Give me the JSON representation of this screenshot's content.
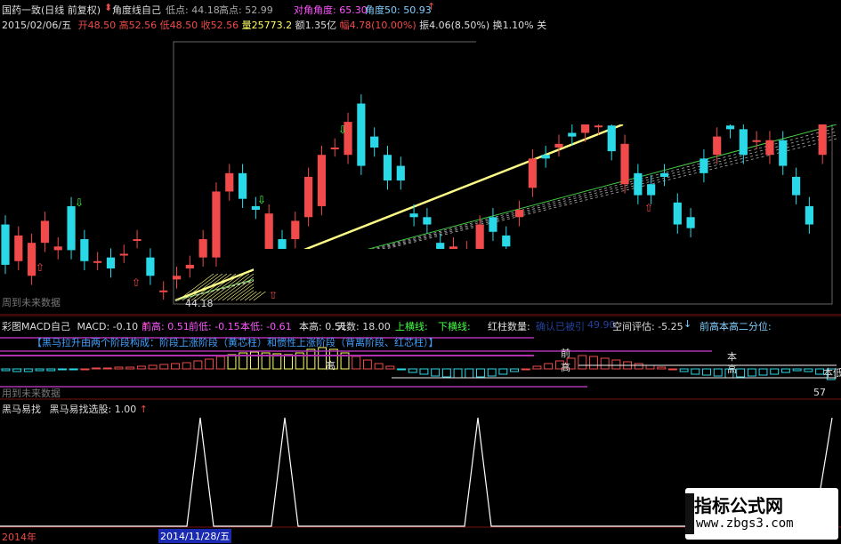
{
  "colors": {
    "up": "#f04a4a",
    "down": "#2ad9e8",
    "bg": "#000000",
    "axis": "#7a1010",
    "yellow": "#ffff66",
    "magenta": "#b030b0"
  },
  "header": {
    "title": "国药一致(日线 前复权)",
    "indicator_name": "角度线自己",
    "low_label": "低点: 44.18",
    "high_label": "高点: 52.99",
    "diag_angle": "对角角度: 65.30",
    "angle50": "角度50: 50.93"
  },
  "info": {
    "date": "2015/02/06/五",
    "open": "开48.50",
    "high": "高52.56",
    "low": "低48.50",
    "close": "收52.56",
    "vol": "量25773.2",
    "amount": "额1.35亿",
    "range": "幅4.78(10.00%)",
    "amp": "振4.06(8.50%)",
    "turn": "换1.10%",
    "tail": "关"
  },
  "price_chart": {
    "low_marker": "44.18",
    "future_label": "周到未来数据"
  },
  "macd_header": {
    "name": "彩图MACD自己",
    "macd": "MACD: -0.10",
    "prev_high": "前高: 0.51",
    "prev_low": "前低: -0.15",
    "cur_low": "本低: -0.61",
    "cur_high": "本高: 0.51",
    "days": "天数: 18.00",
    "up_line": "上横线:",
    "down_line": "下横线:",
    "red_count": "红柱数量:",
    "blurred": "确认已被引",
    "blurred_val": "49.90",
    "space": "空间评估: -5.25",
    "high2": "前高本高二分位:"
  },
  "macd_chart": {
    "banner": "【黑马拉升由两个阶段构成：阶段上涨阶段（黄芯柱）和惯性上涨阶段（背离阶段、红芯柱）】",
    "gao": "高",
    "qian": "前",
    "ben": "本",
    "lian": "本低",
    "val57": "57",
    "future_label": "用到未来数据"
  },
  "signal_header": {
    "name": "黑马易找",
    "value": "黑马易找选股: 1.00"
  },
  "footer": {
    "year": "2014年",
    "date": "2014/11/28/五"
  },
  "watermark": {
    "title": "指标公式网",
    "url": "www.zbgs3.com"
  },
  "chart_data": {
    "type": "candlestick",
    "candles": [
      {
        "o": 49.3,
        "c": 48.2
      },
      {
        "o": 48.3,
        "c": 49.0
      },
      {
        "o": 47.9,
        "c": 48.8
      },
      {
        "o": 48.8,
        "c": 49.4
      },
      {
        "o": 48.6,
        "c": 48.7
      },
      {
        "o": 49.8,
        "c": 48.6
      },
      {
        "o": 48.9,
        "c": 48.3
      },
      {
        "o": 48.3,
        "c": 48.3
      },
      {
        "o": 48.4,
        "c": 48.1
      },
      {
        "o": 48.5,
        "c": 48.5
      },
      {
        "o": 48.9,
        "c": 48.9
      },
      {
        "o": 48.4,
        "c": 47.9
      },
      {
        "o": 47.5,
        "c": 47.5
      },
      {
        "o": 47.8,
        "c": 47.9
      },
      {
        "o": 48.1,
        "c": 48.2
      },
      {
        "o": 48.4,
        "c": 48.9
      },
      {
        "o": 48.4,
        "c": 50.2
      },
      {
        "o": 50.2,
        "c": 50.7
      },
      {
        "o": 50.7,
        "c": 50.0
      },
      {
        "o": 49.8,
        "c": 49.7
      },
      {
        "o": 48.4,
        "c": 49.6
      },
      {
        "o": 48.9,
        "c": 48.5
      },
      {
        "o": 48.9,
        "c": 49.4
      },
      {
        "o": 49.5,
        "c": 50.6
      },
      {
        "o": 49.8,
        "c": 51.2
      },
      {
        "o": 51.4,
        "c": 51.4
      },
      {
        "o": 51.2,
        "c": 52.1
      },
      {
        "o": 52.6,
        "c": 50.9
      },
      {
        "o": 51.7,
        "c": 51.4
      },
      {
        "o": 51.2,
        "c": 50.5
      },
      {
        "o": 50.9,
        "c": 50.5
      },
      {
        "o": 49.6,
        "c": 49.5
      },
      {
        "o": 49.5,
        "c": 49.3
      },
      {
        "o": 48.8,
        "c": 48.5
      },
      {
        "o": 48.5,
        "c": 48.7
      },
      {
        "o": 48.4,
        "c": 48.6
      },
      {
        "o": 48.6,
        "c": 49.3
      },
      {
        "o": 49.5,
        "c": 49.1
      },
      {
        "o": 49.0,
        "c": 48.7
      },
      {
        "o": 49.5,
        "c": 49.7
      },
      {
        "o": 50.3,
        "c": 51.1
      },
      {
        "o": 51.2,
        "c": 51.1
      },
      {
        "o": 51.4,
        "c": 51.5
      },
      {
        "o": 51.8,
        "c": 51.7
      },
      {
        "o": 51.8,
        "c": 52.3
      },
      {
        "o": 52.0,
        "c": 52.0
      },
      {
        "o": 52.0,
        "c": 51.3
      },
      {
        "o": 50.4,
        "c": 51.5
      },
      {
        "o": 50.7,
        "c": 50.1
      },
      {
        "o": 50.4,
        "c": 50.1
      },
      {
        "o": 50.7,
        "c": 50.6
      },
      {
        "o": 49.9,
        "c": 49.3
      },
      {
        "o": 49.5,
        "c": 49.2
      },
      {
        "o": 51.1,
        "c": 50.7
      },
      {
        "o": 51.2,
        "c": 51.7
      },
      {
        "o": 52.0,
        "c": 51.9
      },
      {
        "o": 51.9,
        "c": 51.2
      },
      {
        "o": 51.6,
        "c": 51.6
      },
      {
        "o": 51.2,
        "c": 51.6
      },
      {
        "o": 51.6,
        "c": 50.9
      },
      {
        "o": 50.6,
        "c": 50.1
      },
      {
        "o": 49.8,
        "c": 49.3
      },
      {
        "o": 51.2,
        "c": 52.5
      }
    ]
  }
}
